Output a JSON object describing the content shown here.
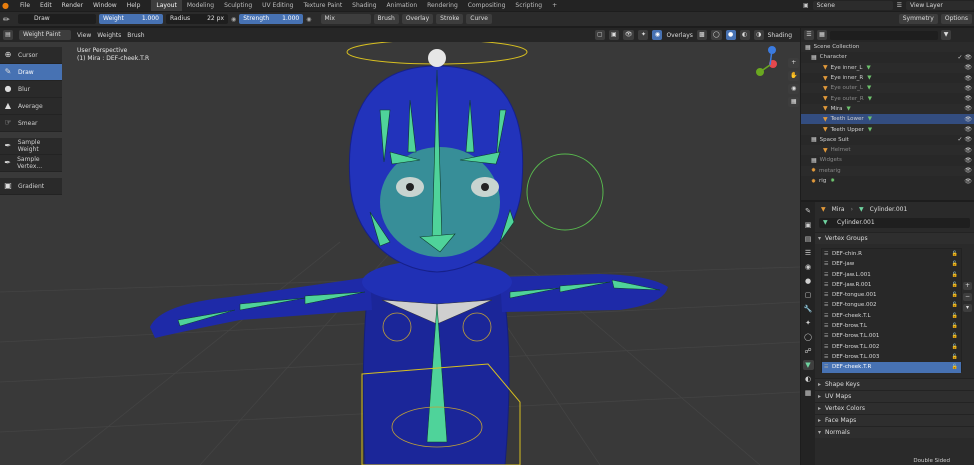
{
  "menubar": {
    "menus": [
      "File",
      "Edit",
      "Render",
      "Window",
      "Help"
    ],
    "workspaces": [
      "Layout",
      "Modeling",
      "Sculpting",
      "UV Editing",
      "Texture Paint",
      "Shading",
      "Animation",
      "Rendering",
      "Compositing",
      "Scripting"
    ],
    "add_tab": "+",
    "scene": "Scene",
    "view_layer": "View Layer"
  },
  "tool_header": {
    "brush_name": "Draw",
    "weight_label": "Weight",
    "weight_value": "1.000",
    "radius_label": "Radius",
    "radius_value": "22 px",
    "strength_label": "Strength",
    "strength_value": "1.000",
    "blend": "Mix",
    "dropdowns": [
      "Brush",
      "Overlay",
      "Stroke",
      "Curve"
    ],
    "symmetry": "Symmetry",
    "options": "Options"
  },
  "viewport_header": {
    "mode": "Weight Paint",
    "menus": [
      "View",
      "Weights",
      "Brush"
    ],
    "overlays": "Overlays",
    "shading": "Shading"
  },
  "viewport": {
    "view_name": "User Perspective",
    "object_info": "(1) Mira : DEF-cheek.T.R"
  },
  "toolbar": {
    "tools": [
      {
        "label": "Cursor",
        "icon": "cursor-icon"
      },
      {
        "label": "Draw",
        "icon": "brush-icon"
      },
      {
        "label": "Blur",
        "icon": "blur-icon"
      },
      {
        "label": "Average",
        "icon": "average-icon"
      },
      {
        "label": "Smear",
        "icon": "smear-icon"
      },
      {
        "label": "Sample Weight",
        "icon": "eyedropper-icon"
      },
      {
        "label": "Sample Vertex...",
        "icon": "eyedropper-icon"
      },
      {
        "label": "Gradient",
        "icon": "gradient-icon"
      }
    ]
  },
  "outliner": {
    "rows": [
      {
        "label": "Scene Collection"
      },
      {
        "label": "Character"
      },
      {
        "label": "Eye inner_L"
      },
      {
        "label": "Eye inner_R"
      },
      {
        "label": "Eye outer_L"
      },
      {
        "label": "Eye outer_R"
      },
      {
        "label": "Mira"
      },
      {
        "label": "Teeth Lower"
      },
      {
        "label": "Teeth Upper"
      },
      {
        "label": "Space Suit"
      },
      {
        "label": "Helmet"
      },
      {
        "label": "Widgets"
      },
      {
        "label": "metarig"
      },
      {
        "label": "rig"
      }
    ]
  },
  "properties": {
    "object": "Mira",
    "mesh": "Cylinder.001",
    "datablock": "Cylinder.001",
    "vertex_groups_title": "Vertex Groups",
    "vertex_groups": [
      "DEF-chin.R",
      "DEF-jaw",
      "DEF-jaw.L.001",
      "DEF-jaw.R.001",
      "DEF-tongue.001",
      "DEF-tongue.002",
      "DEF-cheek.T.L",
      "DEF-brow.T.L",
      "DEF-brow.T.L.001",
      "DEF-brow.T.L.002",
      "DEF-brow.T.L.003",
      "DEF-cheek.T.R"
    ],
    "panels": [
      "Shape Keys",
      "UV Maps",
      "Vertex Colors",
      "Face Maps",
      "Normals"
    ],
    "double_sided": "Double Sided"
  },
  "colors": {
    "accent_blue": "#4772b3",
    "mesh_blue": "#1e2aa8",
    "bone_green": "#4fd39a"
  }
}
